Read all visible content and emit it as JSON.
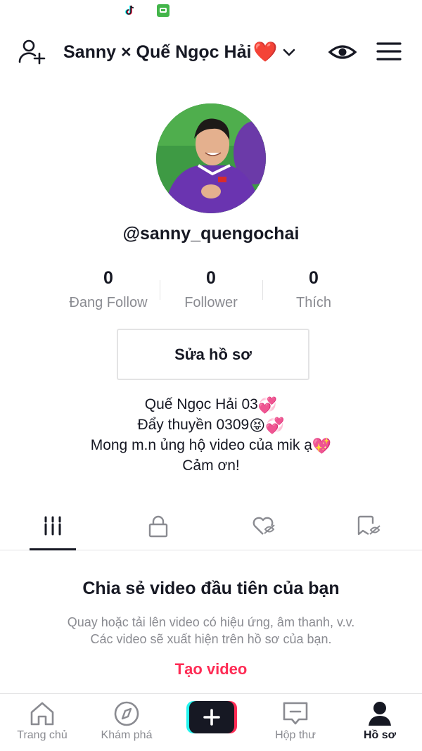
{
  "header": {
    "title": "Sanny × Quế Ngọc Hải",
    "title_emoji": "❤️"
  },
  "profile": {
    "username": "@sanny_quengochai",
    "stats": [
      {
        "value": "0",
        "label": "Đang Follow"
      },
      {
        "value": "0",
        "label": "Follower"
      },
      {
        "value": "0",
        "label": "Thích"
      }
    ],
    "edit_button": "Sửa hồ sơ",
    "bio": [
      {
        "text": "Quế Ngọc Hải 03",
        "emoji": "💞"
      },
      {
        "text": "Đẩy thuyền 0309",
        "emoji": "😝💞"
      },
      {
        "text": "Mong m.n ủng hộ video của mik ạ",
        "emoji": "💖"
      },
      {
        "text": "Cảm ơn!",
        "emoji": ""
      }
    ]
  },
  "tabs": [
    {
      "icon": "videos-grid-icon",
      "active": true
    },
    {
      "icon": "lock-icon",
      "active": false
    },
    {
      "icon": "liked-hidden-icon",
      "active": false
    },
    {
      "icon": "favorites-hidden-icon",
      "active": false
    }
  ],
  "empty_state": {
    "title": "Chia sẻ video đầu tiên của bạn",
    "line1": "Quay hoặc tải lên video có hiệu ứng, âm thanh, v.v.",
    "line2": "Các video sẽ xuất hiện trên hồ sơ của bạn.",
    "action": "Tạo video"
  },
  "bottom_nav": [
    {
      "label": "Trang chủ",
      "icon": "home-icon",
      "active": false
    },
    {
      "label": "Khám phá",
      "icon": "compass-icon",
      "active": false
    },
    {
      "label": "",
      "icon": "plus-icon",
      "active": false
    },
    {
      "label": "Hộp thư",
      "icon": "inbox-icon",
      "active": false
    },
    {
      "label": "Hồ sơ",
      "icon": "profile-icon",
      "active": true
    }
  ],
  "colors": {
    "accent": "#fe2c55",
    "text": "#161823",
    "muted": "#8a8b91",
    "divider": "#e3e3e4"
  }
}
